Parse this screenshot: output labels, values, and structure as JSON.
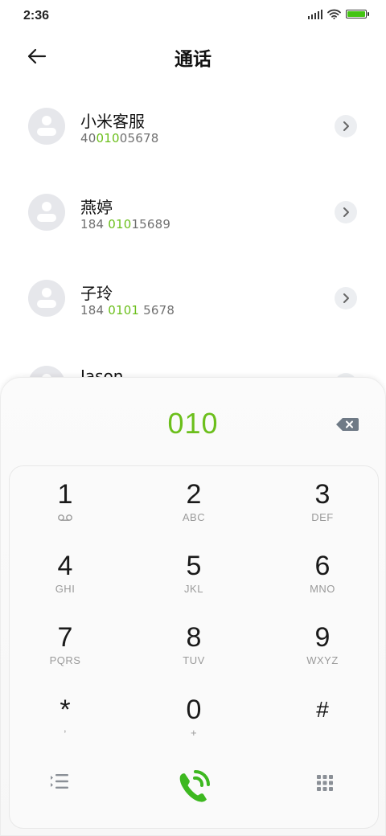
{
  "status": {
    "time": "2:36",
    "battery_level": 1.0
  },
  "header": {
    "title": "通话"
  },
  "contacts": [
    {
      "name": "小米客服",
      "number_pre": "40",
      "number_match": "010",
      "number_post": "05678"
    },
    {
      "name": "燕婷",
      "number_pre": "184 ",
      "number_match": "010",
      "number_post": "15689"
    },
    {
      "name": "子玲",
      "number_pre": "184 ",
      "number_match": "0101",
      "number_post": " 5678"
    },
    {
      "name": "Jason",
      "number_pre": "",
      "number_match": "",
      "number_post": ""
    }
  ],
  "dialpad": {
    "display": "010",
    "keys": [
      {
        "digit": "1",
        "letters": ""
      },
      {
        "digit": "2",
        "letters": "ABC"
      },
      {
        "digit": "3",
        "letters": "DEF"
      },
      {
        "digit": "4",
        "letters": "GHI"
      },
      {
        "digit": "5",
        "letters": "JKL"
      },
      {
        "digit": "6",
        "letters": "MNO"
      },
      {
        "digit": "7",
        "letters": "PQRS"
      },
      {
        "digit": "8",
        "letters": "TUV"
      },
      {
        "digit": "9",
        "letters": "WXYZ"
      },
      {
        "digit": "*",
        "letters": ","
      },
      {
        "digit": "0",
        "letters": "+"
      },
      {
        "digit": "#",
        "letters": ""
      }
    ]
  },
  "icons": {
    "back": "arrow-left-icon",
    "chevron": "chevron-right-icon",
    "delete": "backspace-icon",
    "voicemail": "voicemail-icon",
    "menu": "call-list-icon",
    "call": "call-icon",
    "keypad": "keypad-grid-icon"
  },
  "colors": {
    "accent": "#6cbf1c",
    "call_button": "#44c414"
  }
}
